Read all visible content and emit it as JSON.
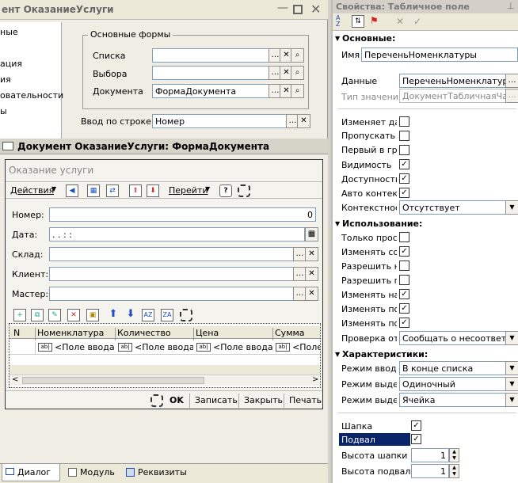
{
  "bg_window": {
    "title": "ент ОказаниеУслуги",
    "tree_items": [
      "ные",
      "",
      "ация",
      "ия",
      "овательности",
      "ы"
    ],
    "group_title": "Основные формы",
    "forms": [
      {
        "label": "Списка",
        "value": ""
      },
      {
        "label": "Выбора",
        "value": ""
      },
      {
        "label": "Документа",
        "value": "ФормаДокумента"
      }
    ],
    "input_label": "Ввод по строке",
    "input_value": "Номер"
  },
  "form_window": {
    "title": "Документ ОказаниеУслуги: ФормаДокумента",
    "caption": "Оказание услуги",
    "actions_label": "Действия",
    "goto_label": "Перейти",
    "fields": [
      {
        "label": "Номер:",
        "value": "0"
      },
      {
        "label": "Дата:",
        "value": ". .   : :"
      },
      {
        "label": "Склад:",
        "value": ""
      },
      {
        "label": "Клиент:",
        "value": ""
      },
      {
        "label": "Мастер:",
        "value": ""
      }
    ],
    "table": {
      "columns": [
        "N",
        "Номенклатура",
        "Количество",
        "Цена",
        "Сумма"
      ],
      "cells": [
        "",
        "<Поле ввода>",
        "<Поле ввода>",
        "<Поле ввода>",
        "<Поле"
      ]
    },
    "buttons": {
      "ok": "OK",
      "save": "Записать",
      "close": "Закрыть",
      "print": "Печать"
    }
  },
  "bottom_tabs": [
    "Диалог",
    "Модуль",
    "Реквизиты"
  ],
  "props": {
    "title": "Свойства: Табличное поле",
    "sec_basic": "Основные:",
    "name_label": "Имя",
    "name_value": "ПереченьНоменклатуры",
    "data_label": "Данные",
    "data_value": "ПереченьНоменклатуры",
    "type_label": "Тип значения",
    "type_value": "ДокументТабличнаяЧа",
    "basic_checks": [
      {
        "label": "Изменяет дан",
        "checked": false
      },
      {
        "label": "Пропускать п",
        "checked": false
      },
      {
        "label": "Первый в груп",
        "checked": false
      },
      {
        "label": "Видимость",
        "checked": true
      },
      {
        "label": "Доступность",
        "checked": true
      },
      {
        "label": "Авто контекст",
        "checked": true
      }
    ],
    "context_label": "Контекстное м",
    "context_value": "Отсутствует",
    "sec_usage": "Использование:",
    "usage_checks": [
      {
        "label": "Только просм",
        "checked": false
      },
      {
        "label": "Изменять сос",
        "checked": true
      },
      {
        "label": "Разрешить на",
        "checked": false
      },
      {
        "label": "Разрешить пе",
        "checked": false
      },
      {
        "label": "Изменять нас",
        "checked": true
      },
      {
        "label": "Изменять поз",
        "checked": true
      },
      {
        "label": "Изменять пор",
        "checked": true
      }
    ],
    "check_label": "Проверка отоб",
    "check_value": "Сообщать о несоответс",
    "sec_char": "Характеристики:",
    "char_rows": [
      {
        "label": "Режим ввода",
        "value": "В конце списка"
      },
      {
        "label": "Режим выдел",
        "value": "Одиночный"
      },
      {
        "label": "Режим выдел",
        "value": "Ячейка"
      }
    ],
    "header_label": "Шапка",
    "footer_label": "Подвал",
    "header_h_label": "Высота шапки",
    "header_h_value": "1",
    "footer_h_label": "Высота подвала",
    "footer_h_value": "1"
  }
}
